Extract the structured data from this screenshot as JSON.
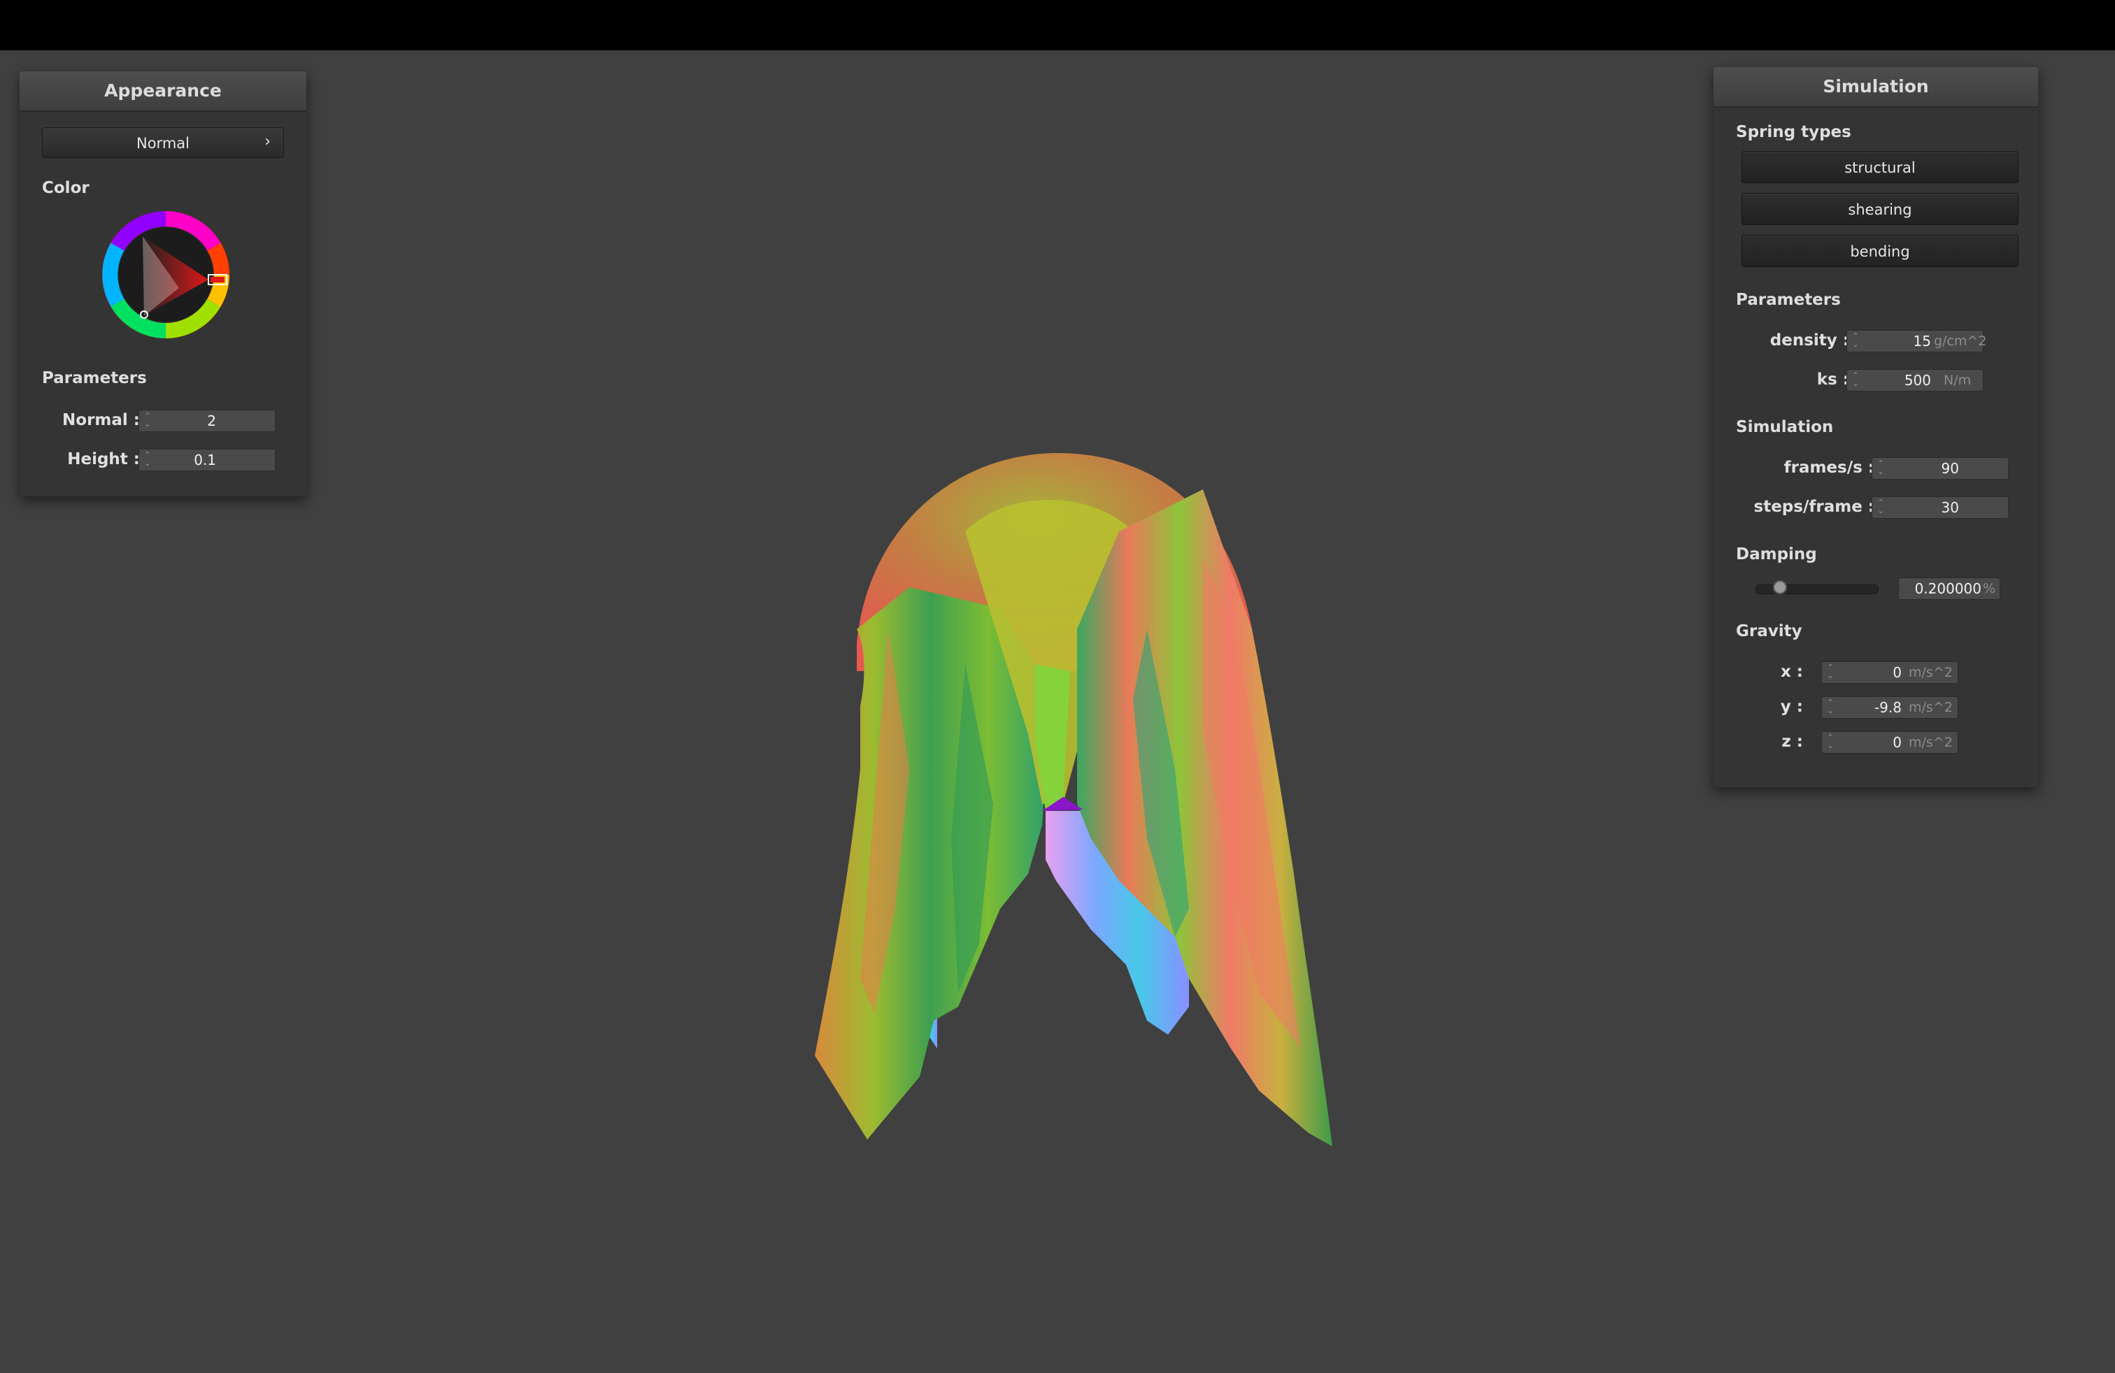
{
  "appearance": {
    "title": "Appearance",
    "shader_select": {
      "label": "Normal",
      "arrow": "›"
    },
    "color_label": "Color",
    "color_wheel": {
      "hue_deg": 0,
      "selected_color": "#e01818"
    },
    "parameters_label": "Parameters",
    "normal": {
      "label": "Normal :",
      "value": "2"
    },
    "height": {
      "label": "Height :",
      "value": "0.1"
    }
  },
  "simulation_panel": {
    "title": "Simulation",
    "spring_types_label": "Spring types",
    "springs": [
      "structural",
      "shearing",
      "bending"
    ],
    "parameters_label": "Parameters",
    "density": {
      "label": "density :",
      "value": "15",
      "unit": "g/cm^2"
    },
    "ks": {
      "label": "ks :",
      "value": "500",
      "unit": "N/m"
    },
    "simulation_label": "Simulation",
    "fps": {
      "label": "frames/s :",
      "value": "90"
    },
    "steps": {
      "label": "steps/frame :",
      "value": "30"
    },
    "damping_label": "Damping",
    "damping": {
      "value": "0.200000",
      "unit": "%",
      "slider_fraction": 0.2
    },
    "gravity_label": "Gravity",
    "gx": {
      "label": "x :",
      "value": "0",
      "unit": "m/s^2"
    },
    "gy": {
      "label": "y :",
      "value": "-9.8",
      "unit": "m/s^2"
    },
    "gz": {
      "label": "z :",
      "value": "0",
      "unit": "m/s^2"
    }
  },
  "colors": {
    "background": "#404040",
    "panel": "#343434",
    "topbar": "#000000"
  }
}
